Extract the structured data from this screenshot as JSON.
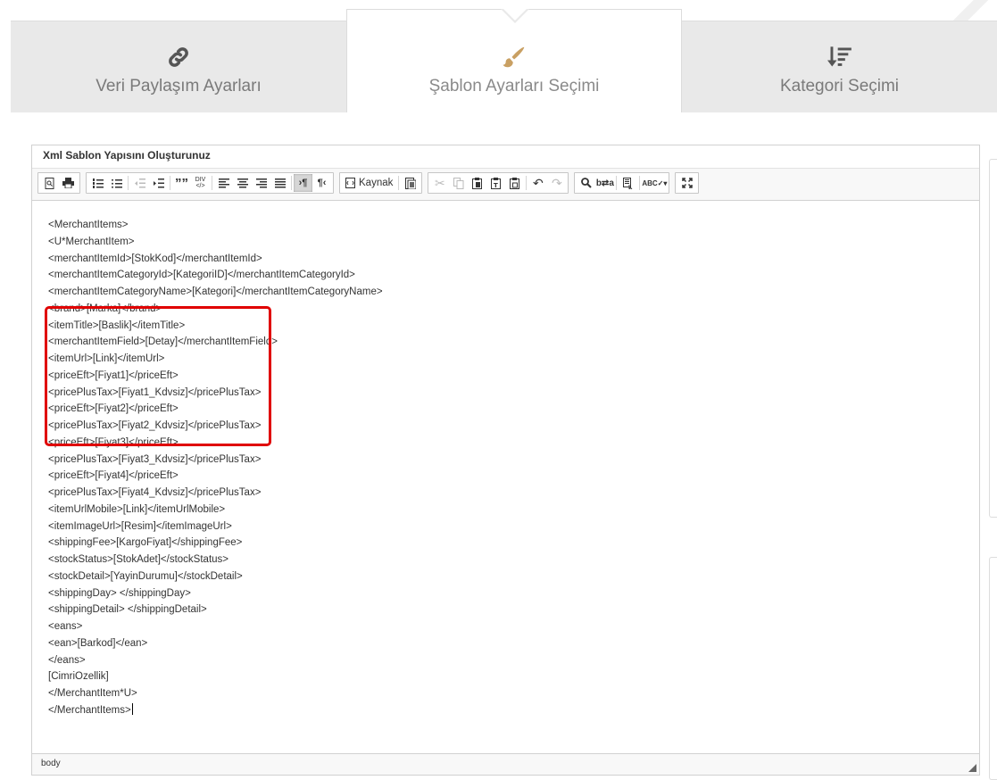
{
  "wizard": {
    "steps": [
      {
        "label": "Veri Paylaşım Ayarları",
        "icon": "link-icon",
        "active": false
      },
      {
        "label": "Şablon Ayarları Seçimi",
        "icon": "brush-icon",
        "active": true
      },
      {
        "label": "Kategori Seçimi",
        "icon": "sort-icon",
        "active": false
      }
    ],
    "icon_color_active": "#c9a063",
    "icon_color_inactive": "#555555"
  },
  "editor": {
    "title": "Xml Sablon Yapısını Oluşturunuz",
    "kaynak_label": "Kaynak",
    "status_path": "body",
    "lines": [
      "<MerchantItems>",
      "<U*MerchantItem>",
      "<merchantItemId>[StokKod]</merchantItemId>",
      "<merchantItemCategoryId>[KategoriID]</merchantItemCategoryId>",
      "<merchantItemCategoryName>[Kategori]</merchantItemCategoryName>",
      "<brand>[Marka]</brand>",
      "<itemTitle>[Baslik]</itemTitle>",
      "<merchantItemField>[Detay]</merchantItemField>",
      "<itemUrl>[Link]</itemUrl>",
      "<priceEft>[Fiyat1]</priceEft>",
      "<pricePlusTax>[Fiyat1_Kdvsiz]</pricePlusTax>",
      "<priceEft>[Fiyat2]</priceEft>",
      "<pricePlusTax>[Fiyat2_Kdvsiz]</pricePlusTax>",
      "<priceEft>[Fiyat3]</priceEft>",
      "<pricePlusTax>[Fiyat3_Kdvsiz]</pricePlusTax>",
      "<priceEft>[Fiyat4]</priceEft>",
      "<pricePlusTax>[Fiyat4_Kdvsiz]</pricePlusTax>",
      "<itemUrlMobile>[Link]</itemUrlMobile>",
      "<itemImageUrl>[Resim]</itemImageUrl>",
      "<shippingFee>[KargoFiyat]</shippingFee>",
      "<stockStatus>[StokAdet]</stockStatus>",
      "<stockDetail>[YayinDurumu]</stockDetail>",
      "<shippingDay> </shippingDay>",
      "<shippingDetail> </shippingDetail>",
      "<eans>",
      "<ean>[Barkod]</ean>",
      "</eans>",
      "[CimriOzellik]",
      "</MerchantItem*U>",
      "</MerchantItems>"
    ],
    "highlight_color": "#e00000"
  }
}
